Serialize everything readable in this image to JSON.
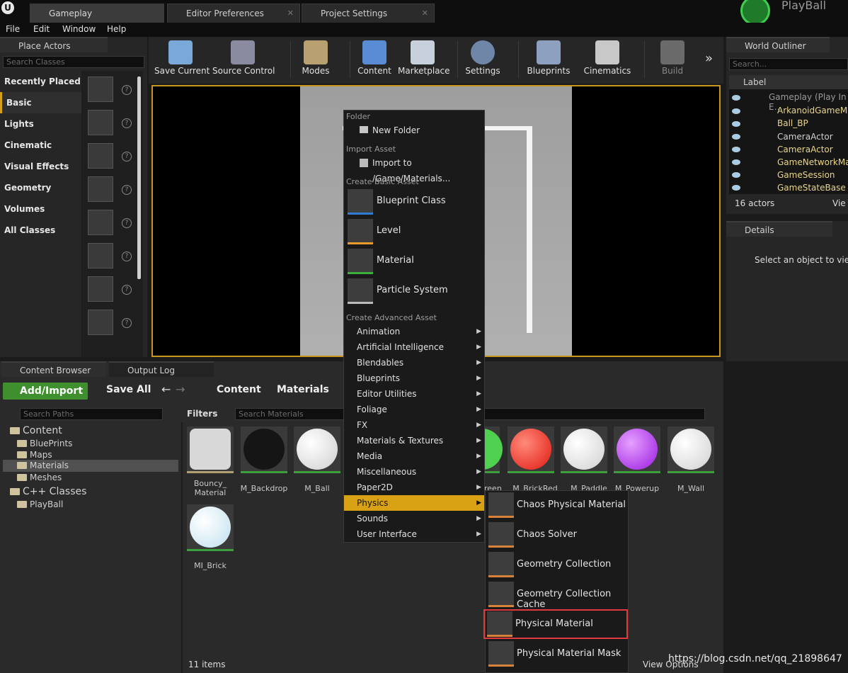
{
  "tabs": {
    "gameplay": "Gameplay",
    "editor_prefs": "Editor Preferences",
    "project_settings": "Project Settings"
  },
  "project_name": "PlayBall",
  "menu": {
    "file": "File",
    "edit": "Edit",
    "window": "Window",
    "help": "Help"
  },
  "place_actors": {
    "title": "Place Actors",
    "search_placeholder": "Search Classes",
    "categories": [
      "Recently Placed",
      "Basic",
      "Lights",
      "Cinematic",
      "Visual Effects",
      "Geometry",
      "Volumes",
      "All Classes"
    ]
  },
  "toolbar": {
    "save_current": "Save Current",
    "source_control": "Source Control",
    "modes": "Modes",
    "content": "Content",
    "marketplace": "Marketplace",
    "settings": "Settings",
    "blueprints": "Blueprints",
    "cinematics": "Cinematics",
    "build": "Build"
  },
  "world_outliner": {
    "title": "World Outliner",
    "search_placeholder": "Search...",
    "label_col": "Label",
    "root": "Gameplay (Play In E…",
    "items": [
      "ArkanoidGameMo",
      "Ball_BP",
      "CameraActor",
      "CameraActor",
      "GameNetworkMar",
      "GameSession",
      "GameStateBase"
    ],
    "count": "16 actors",
    "view": "Vie"
  },
  "details": {
    "title": "Details",
    "hint": "Select an object to view d"
  },
  "content_browser": {
    "tab": "Content Browser",
    "output_tab": "Output Log",
    "add_import": "Add/Import",
    "save_all": "Save All",
    "path_content": "Content",
    "path_materials": "Materials",
    "search_paths": "Search Paths",
    "filters": "Filters",
    "search_materials": "Search Materials",
    "tree": {
      "content": "Content",
      "blueprints": "BluePrints",
      "maps": "Maps",
      "materials": "Materials",
      "meshes": "Meshes",
      "cpp": "C++ Classes",
      "playball": "PlayBall"
    },
    "assets": [
      "Bouncy_\nMaterial",
      "M_Backdrop",
      "M_Ball",
      "reen",
      "M_BrickRed",
      "M_Paddle",
      "M_Powerup",
      "M_Wall",
      "MI_Brick"
    ],
    "item_count": "11 items",
    "view_options": "View Options"
  },
  "context_menu": {
    "folder_section": "Folder",
    "new_folder": "New Folder",
    "import_section": "Import Asset",
    "import_to": "Import to /Game/Materials...",
    "basic_section": "Create Basic Asset",
    "basic": [
      "Blueprint Class",
      "Level",
      "Material",
      "Particle System"
    ],
    "advanced_section": "Create Advanced Asset",
    "advanced": [
      "Animation",
      "Artificial Intelligence",
      "Blendables",
      "Blueprints",
      "Editor Utilities",
      "Foliage",
      "FX",
      "Materials & Textures",
      "Media",
      "Miscellaneous",
      "Paper2D",
      "Physics",
      "Sounds",
      "User Interface"
    ]
  },
  "physics_submenu": [
    "Chaos Physical Material",
    "Chaos Solver",
    "Geometry Collection",
    "Geometry Collection Cache",
    "Physical Material",
    "Physical Material Mask"
  ],
  "watermark": "https://blog.csdn.net/qq_21898647"
}
